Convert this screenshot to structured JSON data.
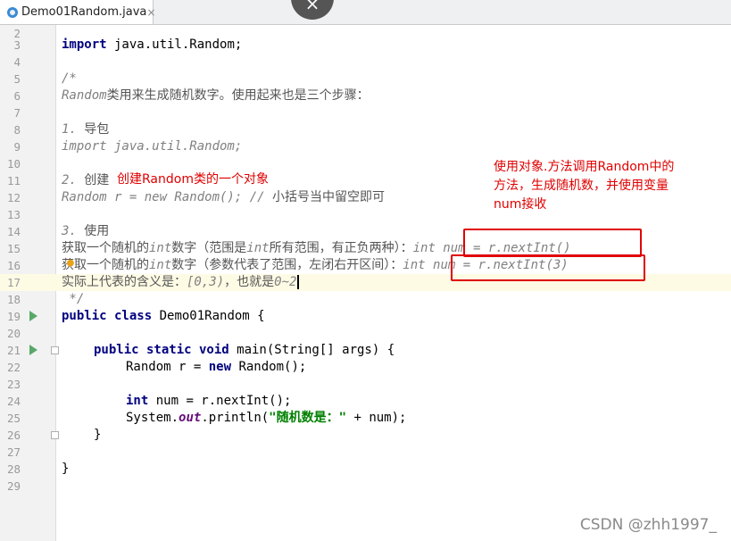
{
  "editor": {
    "tab_title": "Demo01Random.java",
    "tab_close": "×",
    "overlay_close": "×"
  },
  "lines": [
    {
      "n": "2"
    },
    {
      "n": "3"
    },
    {
      "n": "4"
    },
    {
      "n": "5"
    },
    {
      "n": "6"
    },
    {
      "n": "7"
    },
    {
      "n": "8"
    },
    {
      "n": "9"
    },
    {
      "n": "10"
    },
    {
      "n": "11"
    },
    {
      "n": "12"
    },
    {
      "n": "13"
    },
    {
      "n": "14"
    },
    {
      "n": "15"
    },
    {
      "n": "16"
    },
    {
      "n": "17"
    },
    {
      "n": "18"
    },
    {
      "n": "19"
    },
    {
      "n": "20"
    },
    {
      "n": "21"
    },
    {
      "n": "22"
    },
    {
      "n": "23"
    },
    {
      "n": "24"
    },
    {
      "n": "25"
    },
    {
      "n": "26"
    },
    {
      "n": "27"
    },
    {
      "n": "28"
    },
    {
      "n": "29"
    }
  ],
  "code": {
    "l3_kw": "import",
    "l3_rest": " java.util.Random;",
    "l5": "/*",
    "l6_a": "Random",
    "l6_b": "类用来生成随机数字。使用起来也是三个步骤：",
    "l8_a": "1. ",
    "l8_b": "导包",
    "l9": "import java.util.Random;",
    "l11_a": "2. ",
    "l11_b": "创建",
    "l12_a": "Random r = new Random(); // ",
    "l12_b": "小括号当中留空即可",
    "l14_a": "3. ",
    "l14_b": "使用",
    "l15_a": "获取一个随机的",
    "l15_b": "int",
    "l15_c": "数字（范围是",
    "l15_d": "int",
    "l15_e": "所有范围，有正负两种）：",
    "l15_f": "int num = r.nextInt()",
    "l16_a": "获取一个随机的",
    "l16_b": "int",
    "l16_c": "数字（参数代表了范围，左闭右开区间）：",
    "l16_d": "int num = r.nextInt(3)",
    "l17_a": "实际上代表的含义是：",
    "l17_b": "[0,3)",
    "l17_c": "，也就是",
    "l17_d": "0~2",
    "l18": " */",
    "l19_kw": "public class",
    "l19_rest": " Demo01Random {",
    "l21_kw": "public static void",
    "l21_rest": " main(String[] args) {",
    "l22_a": "Random r = ",
    "l22_kw": "new",
    "l22_b": " Random();",
    "l24_kw": "int",
    "l24_rest": " num = r.nextInt();",
    "l25_a": "System.",
    "l25_out": "out",
    "l25_b": ".println(",
    "l25_str": "\"随机数是：\"",
    "l25_c": " + num);",
    "l26": "}",
    "l28": "}"
  },
  "annotations": {
    "create_note": "创建Random类的一个对象",
    "use_note_1": "使用对象.方法调用Random中的",
    "use_note_2": "方法，生成随机数，并使用变量",
    "use_note_3": "num接收"
  },
  "watermark": "CSDN @zhh1997_",
  "colors": {
    "keyword": "#000080",
    "comment": "#808080",
    "string": "#008000",
    "annotation": "#e00000",
    "current_line": "#fefbe5"
  }
}
